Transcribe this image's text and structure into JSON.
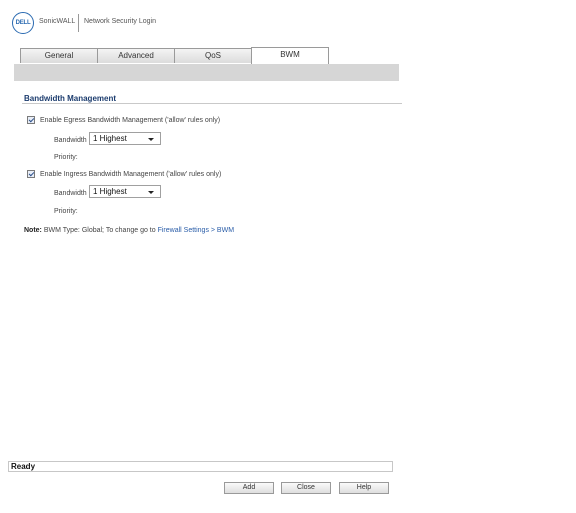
{
  "header": {
    "logo_text": "DELL",
    "brand": "SonicWALL",
    "title": "Network Security Login"
  },
  "tabs": [
    {
      "label": "General",
      "active": false
    },
    {
      "label": "Advanced",
      "active": false
    },
    {
      "label": "QoS",
      "active": false
    },
    {
      "label": "BWM",
      "active": true
    }
  ],
  "section": {
    "title": "Bandwidth Management"
  },
  "egress": {
    "checked": true,
    "label": "Enable Egress Bandwidth Management ('allow' rules only)",
    "bandwidth_label": "Bandwidth",
    "bandwidth_value": "1 Highest",
    "priority_label": "Priority:"
  },
  "ingress": {
    "checked": true,
    "label": "Enable Ingress Bandwidth Management ('allow' rules only)",
    "bandwidth_label": "Bandwidth",
    "bandwidth_value": "1 Highest",
    "priority_label": "Priority:"
  },
  "note": {
    "prefix": "Note:",
    "text": " BWM Type: Global; To change go to ",
    "link": "Firewall Settings > BWM"
  },
  "status": {
    "text": "Ready"
  },
  "buttons": {
    "add": "Add",
    "close": "Close",
    "help": "Help"
  },
  "colors": {
    "link": "#2a5da8",
    "section_title": "#1c3c6e",
    "band": "#d6d6d6"
  }
}
